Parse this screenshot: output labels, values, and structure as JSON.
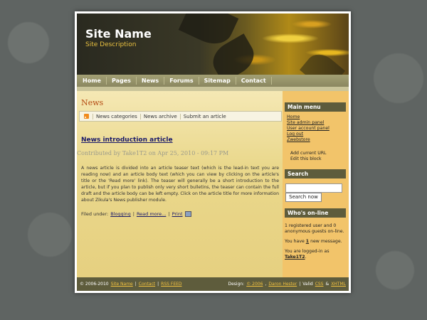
{
  "header": {
    "site_name": "Site Name",
    "site_description": "Site Description"
  },
  "nav": {
    "items": [
      {
        "label": "Home"
      },
      {
        "label": "Pages"
      },
      {
        "label": "News"
      },
      {
        "label": "Forums"
      },
      {
        "label": "Sitemap"
      },
      {
        "label": "Contact"
      }
    ]
  },
  "main": {
    "heading": "News",
    "tabs": [
      {
        "label": "News categories"
      },
      {
        "label": "News archive"
      },
      {
        "label": "Submit an article"
      }
    ],
    "article": {
      "title": "News introduction article",
      "meta": "Contributed by Take1T2 on Apr 25, 2010 - 09:17 PM",
      "body": "A news article is divided into an article teaser text (which is the lead-in text you are reading now) and an article body text (which you can view by clicking on the article's title or the 'Read more' link). The teaser will generally be a short introduction to the article, but if you plan to publish only very short bulletins, the teaser can contain the full draft and the article body can be left empty. Click on the article title for more information about Zikula's News publisher module.",
      "filed_label": "Filed under:",
      "category": "Blogging",
      "read_more": "Read more...",
      "print": "Print"
    }
  },
  "sidebar": {
    "main_menu_title": "Main menu",
    "main_menu_links": [
      "Home",
      "Site admin panel",
      "User account panel",
      "Log out",
      "Zwebstore"
    ],
    "extra_links": [
      "Add current URL",
      "Edit this block"
    ],
    "search_title": "Search",
    "search_placeholder": "",
    "search_button": "Search now",
    "online_title": "Who's on-line",
    "online_stats": "1 registered user and 0 anonymous guests on-line.",
    "messages_prefix": "You have",
    "messages_count": "1",
    "messages_suffix": "new message.",
    "logged_in_prefix": "You are logged-in as",
    "logged_in_user": "Take1T2"
  },
  "footer": {
    "copyright": "© 2006-2010",
    "site_link": "Site Name",
    "contact": "Contact",
    "rss": "RSS FEED",
    "design_prefix": "Design:",
    "design_year": "© 2006",
    "designer": "Daron Hester",
    "valid_label": "Valid",
    "css": "CSS",
    "amp": "&",
    "xhtml": "XHTML"
  }
}
